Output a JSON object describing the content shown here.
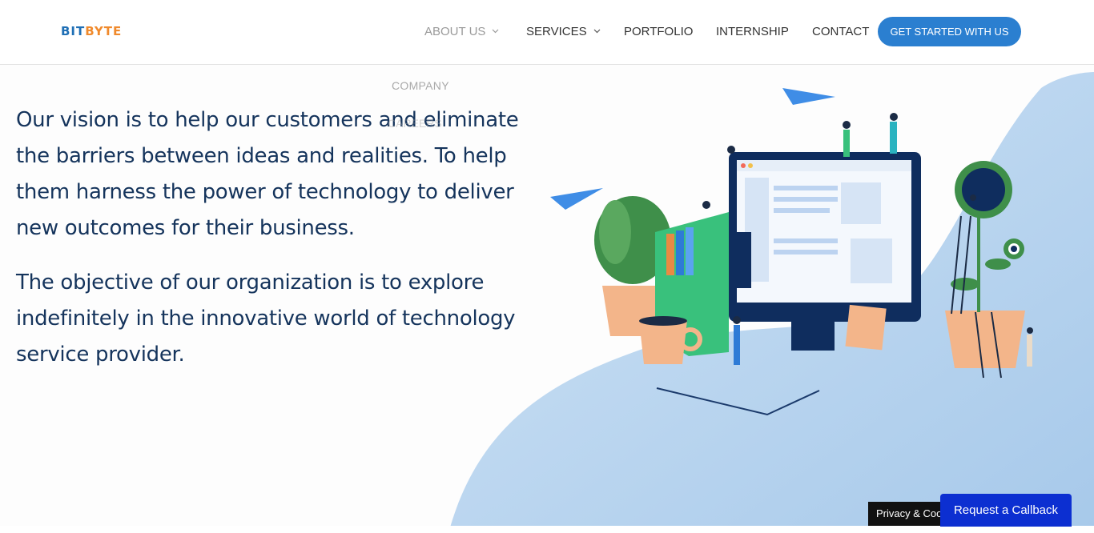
{
  "brand": {
    "part1": "BIT",
    "part2": "BYTE"
  },
  "nav": {
    "items": [
      {
        "label": "ABOUT US",
        "has_dropdown": true
      },
      {
        "label": "SERVICES",
        "has_dropdown": true
      },
      {
        "label": "PORTFOLIO",
        "has_dropdown": false
      },
      {
        "label": "INTERNSHIP",
        "has_dropdown": false
      },
      {
        "label": "CONTACT",
        "has_dropdown": false
      }
    ],
    "cta_label": "GET STARTED WITH US"
  },
  "dropdown": {
    "item1": "COMPANY",
    "item2": "CAREERS"
  },
  "hero": {
    "paragraph1": "Our vision is to help our customers and eliminate the barriers between ideas and realities. To help them harness the power of technology to deliver new outcomes for their business.",
    "paragraph2": "The objective of our organization is to explore indefinitely in the innovative world of  technology service provider."
  },
  "footer": {
    "privacy_label": "Privacy & Cookies",
    "callback_label": "Request a Callback"
  },
  "colors": {
    "primary": "#2b7fd0",
    "text_dark": "#15345c",
    "callback_bg": "#0c2fd1",
    "blob": "#b9d5ef",
    "brand_orange": "#f08a2c"
  }
}
